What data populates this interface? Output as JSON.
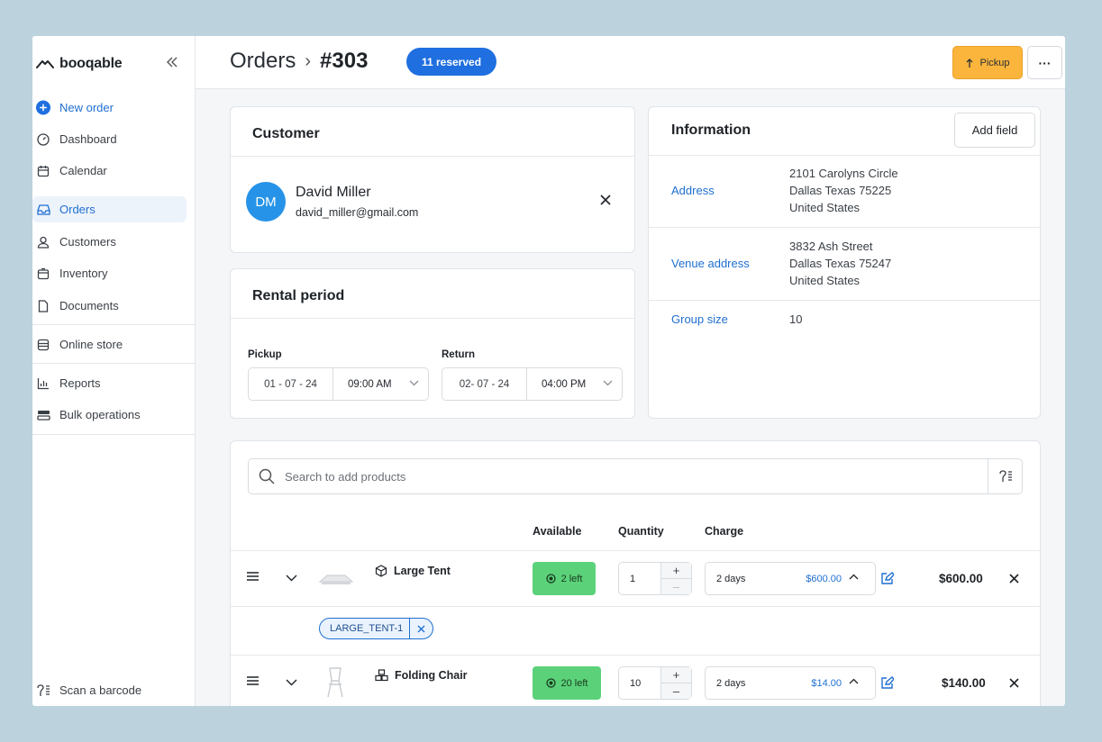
{
  "brand": {
    "name": "booqable"
  },
  "sidebar": {
    "new_order": "New order",
    "items": [
      {
        "label": "Dashboard"
      },
      {
        "label": "Calendar"
      },
      {
        "label": "Orders"
      },
      {
        "label": "Customers"
      },
      {
        "label": "Inventory"
      },
      {
        "label": "Documents"
      },
      {
        "label": "Online store"
      },
      {
        "label": "Reports"
      },
      {
        "label": "Bulk operations"
      }
    ],
    "scan_barcode": "Scan a barcode"
  },
  "header": {
    "section": "Orders",
    "separator": "›",
    "order_number": "#303",
    "status_badge": "11 reserved",
    "pickup_label": "Pickup",
    "more_label": "···"
  },
  "customer": {
    "title": "Customer",
    "initials": "DM",
    "name": "David Miller",
    "email": "david_miller@gmail.com"
  },
  "rental": {
    "title": "Rental period",
    "pickup_label": "Pickup",
    "pickup_date": "01 - 07 - 24",
    "pickup_time": "09:00 AM",
    "return_label": "Return",
    "return_date": "02- 07 - 24",
    "return_time": "04:00 PM"
  },
  "information": {
    "title": "Information",
    "add_field": "Add field",
    "rows": [
      {
        "label": "Address",
        "lines": [
          "2101 Carolyns Circle",
          "Dallas Texas 75225",
          "United States"
        ]
      },
      {
        "label": "Venue address",
        "lines": [
          "3832 Ash Street",
          "Dallas Texas 75247",
          "United States"
        ]
      },
      {
        "label": "Group size",
        "lines": [
          "10"
        ]
      }
    ]
  },
  "products": {
    "search_placeholder": "Search to add products",
    "columns": {
      "available": "Available",
      "quantity": "Quantity",
      "charge": "Charge"
    },
    "rows": [
      {
        "name": "Large Tent",
        "available": "2 left",
        "quantity": "1",
        "charge_period": "2 days",
        "charge_price": "$600.00",
        "total": "$600.00",
        "tag": "LARGE_TENT-1"
      },
      {
        "name": "Folding Chair",
        "available": "20 left",
        "quantity": "10",
        "charge_period": "2 days",
        "charge_price": "$14.00",
        "total": "$140.00"
      }
    ]
  },
  "colors": {
    "accent": "#1f6fe0",
    "pickup": "#fbb53c",
    "available": "#5bd27a",
    "background": "#bcd3dd"
  }
}
